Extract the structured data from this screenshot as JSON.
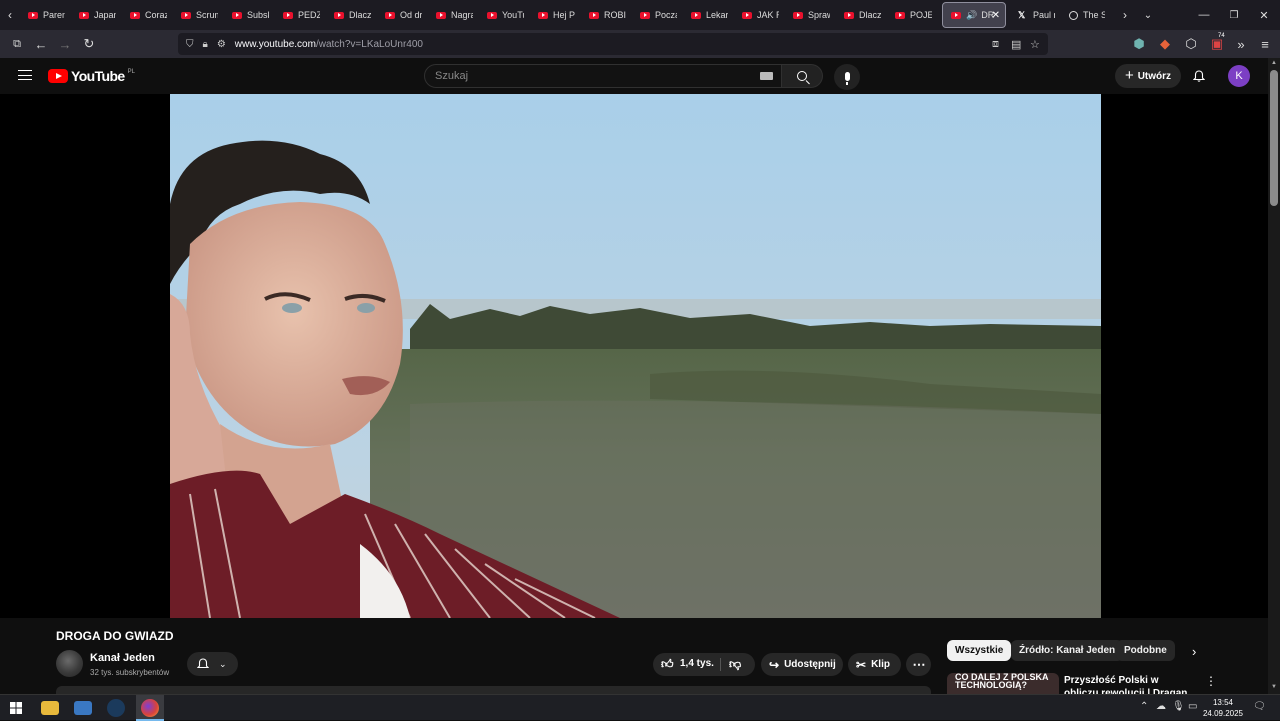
{
  "browser": {
    "tabs": [
      {
        "label": "Parent"
      },
      {
        "label": "Japan"
      },
      {
        "label": "Coraz"
      },
      {
        "label": "Scrum"
      },
      {
        "label": "Subsk"
      },
      {
        "label": "PEDZI"
      },
      {
        "label": "Dlacz"
      },
      {
        "label": "Od dr"
      },
      {
        "label": "Nagra"
      },
      {
        "label": "YouTu"
      },
      {
        "label": "Hej Pu"
      },
      {
        "label": "ROBIM"
      },
      {
        "label": "Począ"
      },
      {
        "label": "Lekar"
      },
      {
        "label": "JAK RO"
      },
      {
        "label": "Spraw"
      },
      {
        "label": "Dlacz"
      },
      {
        "label": "POJEC"
      }
    ],
    "active_tab": {
      "label": "DRO"
    },
    "after_tabs": [
      {
        "label": "Paul m"
      },
      {
        "label": "The Sp"
      }
    ],
    "url_host": "www.youtube.com",
    "url_path": "/watch?v=LKaLoUnr400",
    "extension_badge": "74"
  },
  "youtube": {
    "logo_text": "YouTube",
    "region": "PL",
    "search_placeholder": "Szukaj",
    "create_label": "Utwórz",
    "avatar_letter": "K"
  },
  "video": {
    "title": "DROGA DO GWIAZD",
    "channel_name": "Kanał Jeden",
    "subscribers": "32 tys. subskrybentów",
    "likes": "1,4 tys.",
    "share_label": "Udostępnij",
    "clip_label": "Klip",
    "more_label": "⋯"
  },
  "sidebar": {
    "chips": [
      {
        "label": "Wszystkie",
        "active": true
      },
      {
        "label": "Źródło: Kanał Jeden",
        "active": false
      },
      {
        "label": "Podobne",
        "active": false
      }
    ],
    "recommended": {
      "thumb_text": "CO DALEJ Z POLSKA TECHNOLOGIĄ?",
      "title": "Przyszłość Polski w obliczu rewolucji | Dragan, Zaremba"
    }
  },
  "taskbar": {
    "time": "13:54",
    "date": "24.09.2025"
  },
  "colors": {
    "yt_red": "#ff0000",
    "bg": "#0f0f0f",
    "chip_active": "#f1f1f1",
    "avatar": "#7c3fc4"
  }
}
